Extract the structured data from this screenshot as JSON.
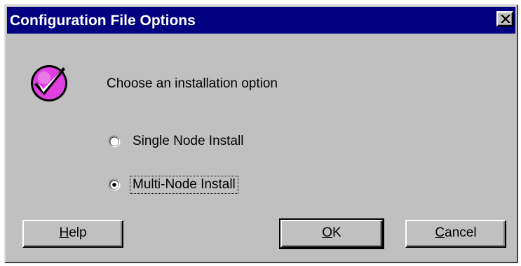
{
  "window": {
    "title": "Configuration File Options",
    "close_icon": "close-icon"
  },
  "main": {
    "icon": "checkmark-icon",
    "prompt": "Choose an installation option",
    "options": [
      {
        "label": "Single Node Install",
        "selected": false
      },
      {
        "label": "Multi-Node Install",
        "selected": true
      }
    ]
  },
  "buttons": {
    "help": {
      "mnemonic": "H",
      "rest": "elp"
    },
    "ok": {
      "mnemonic": "O",
      "rest": "K"
    },
    "cancel": {
      "mnemonic": "C",
      "rest": "ancel"
    }
  },
  "colors": {
    "titlebar": "#000080",
    "dialog_face": "#c0c0c0",
    "icon_magenta": "#e040e0"
  }
}
